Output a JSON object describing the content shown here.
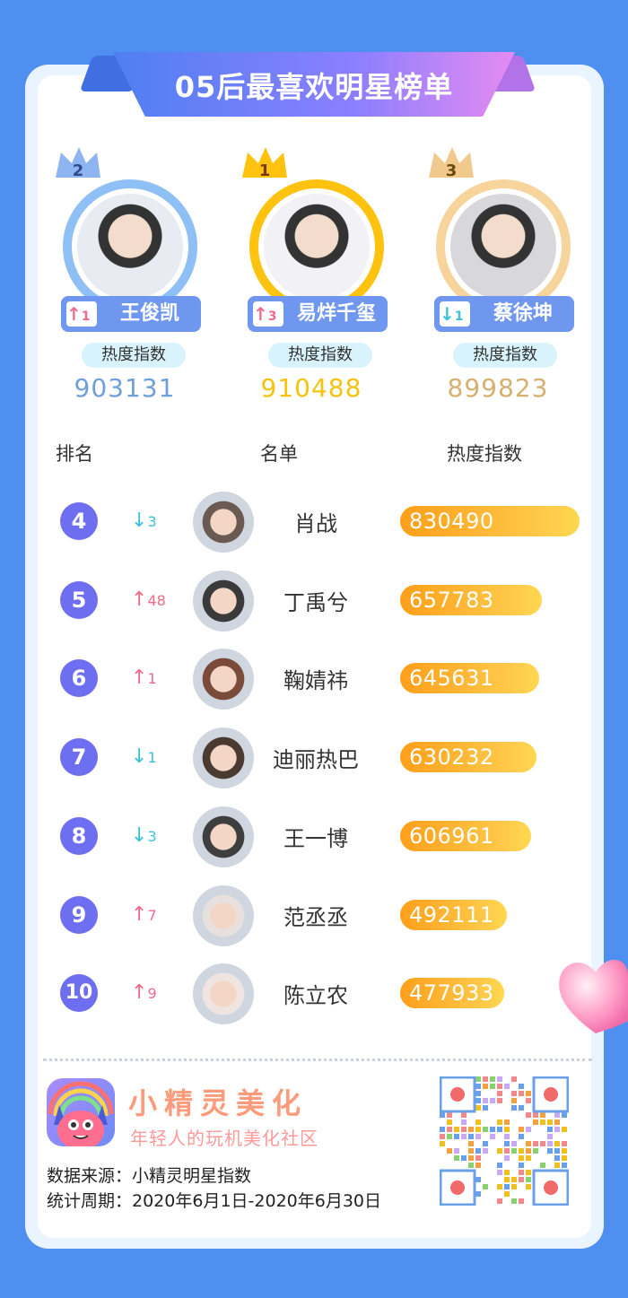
{
  "title": "05后最喜欢明星榜单",
  "top3": [
    {
      "rank": "2",
      "change_dir": "up",
      "change": "1",
      "name": "王俊凯",
      "heat_label": "热度指数",
      "heat": "903131"
    },
    {
      "rank": "1",
      "change_dir": "up",
      "change": "3",
      "name": "易烊千玺",
      "heat_label": "热度指数",
      "heat": "910488"
    },
    {
      "rank": "3",
      "change_dir": "down",
      "change": "1",
      "name": "蔡徐坤",
      "heat_label": "热度指数",
      "heat": "899823"
    }
  ],
  "columns": {
    "rank": "排名",
    "name": "名单",
    "heat": "热度指数"
  },
  "rows": [
    {
      "rank": "4",
      "change_dir": "down",
      "change": "3",
      "name": "肖战",
      "heat": "830490",
      "heat_value": 830490
    },
    {
      "rank": "5",
      "change_dir": "up",
      "change": "48",
      "name": "丁禹兮",
      "heat": "657783",
      "heat_value": 657783
    },
    {
      "rank": "6",
      "change_dir": "up",
      "change": "1",
      "name": "鞠婧祎",
      "heat": "645631",
      "heat_value": 645631
    },
    {
      "rank": "7",
      "change_dir": "down",
      "change": "1",
      "name": "迪丽热巴",
      "heat": "630232",
      "heat_value": 630232
    },
    {
      "rank": "8",
      "change_dir": "down",
      "change": "3",
      "name": "王一博",
      "heat": "606961",
      "heat_value": 606961
    },
    {
      "rank": "9",
      "change_dir": "up",
      "change": "7",
      "name": "范丞丞",
      "heat": "492111",
      "heat_value": 492111
    },
    {
      "rank": "10",
      "change_dir": "up",
      "change": "9",
      "name": "陈立农",
      "heat": "477933",
      "heat_value": 477933
    }
  ],
  "footer": {
    "app_name": "小精灵美化",
    "app_slogan": "年轻人的玩机美化社区",
    "source": "数据来源：小精灵明星指数",
    "period": "统计周期：2020年6月1日-2020年6月30日"
  },
  "colors": {
    "up": "#f06a8a",
    "down": "#3bc2d8",
    "gold": "#ffc20e",
    "silver_blue": "#7aaef0",
    "bronze": "#f2c98c",
    "rank_badge": "#6e6ef0"
  }
}
